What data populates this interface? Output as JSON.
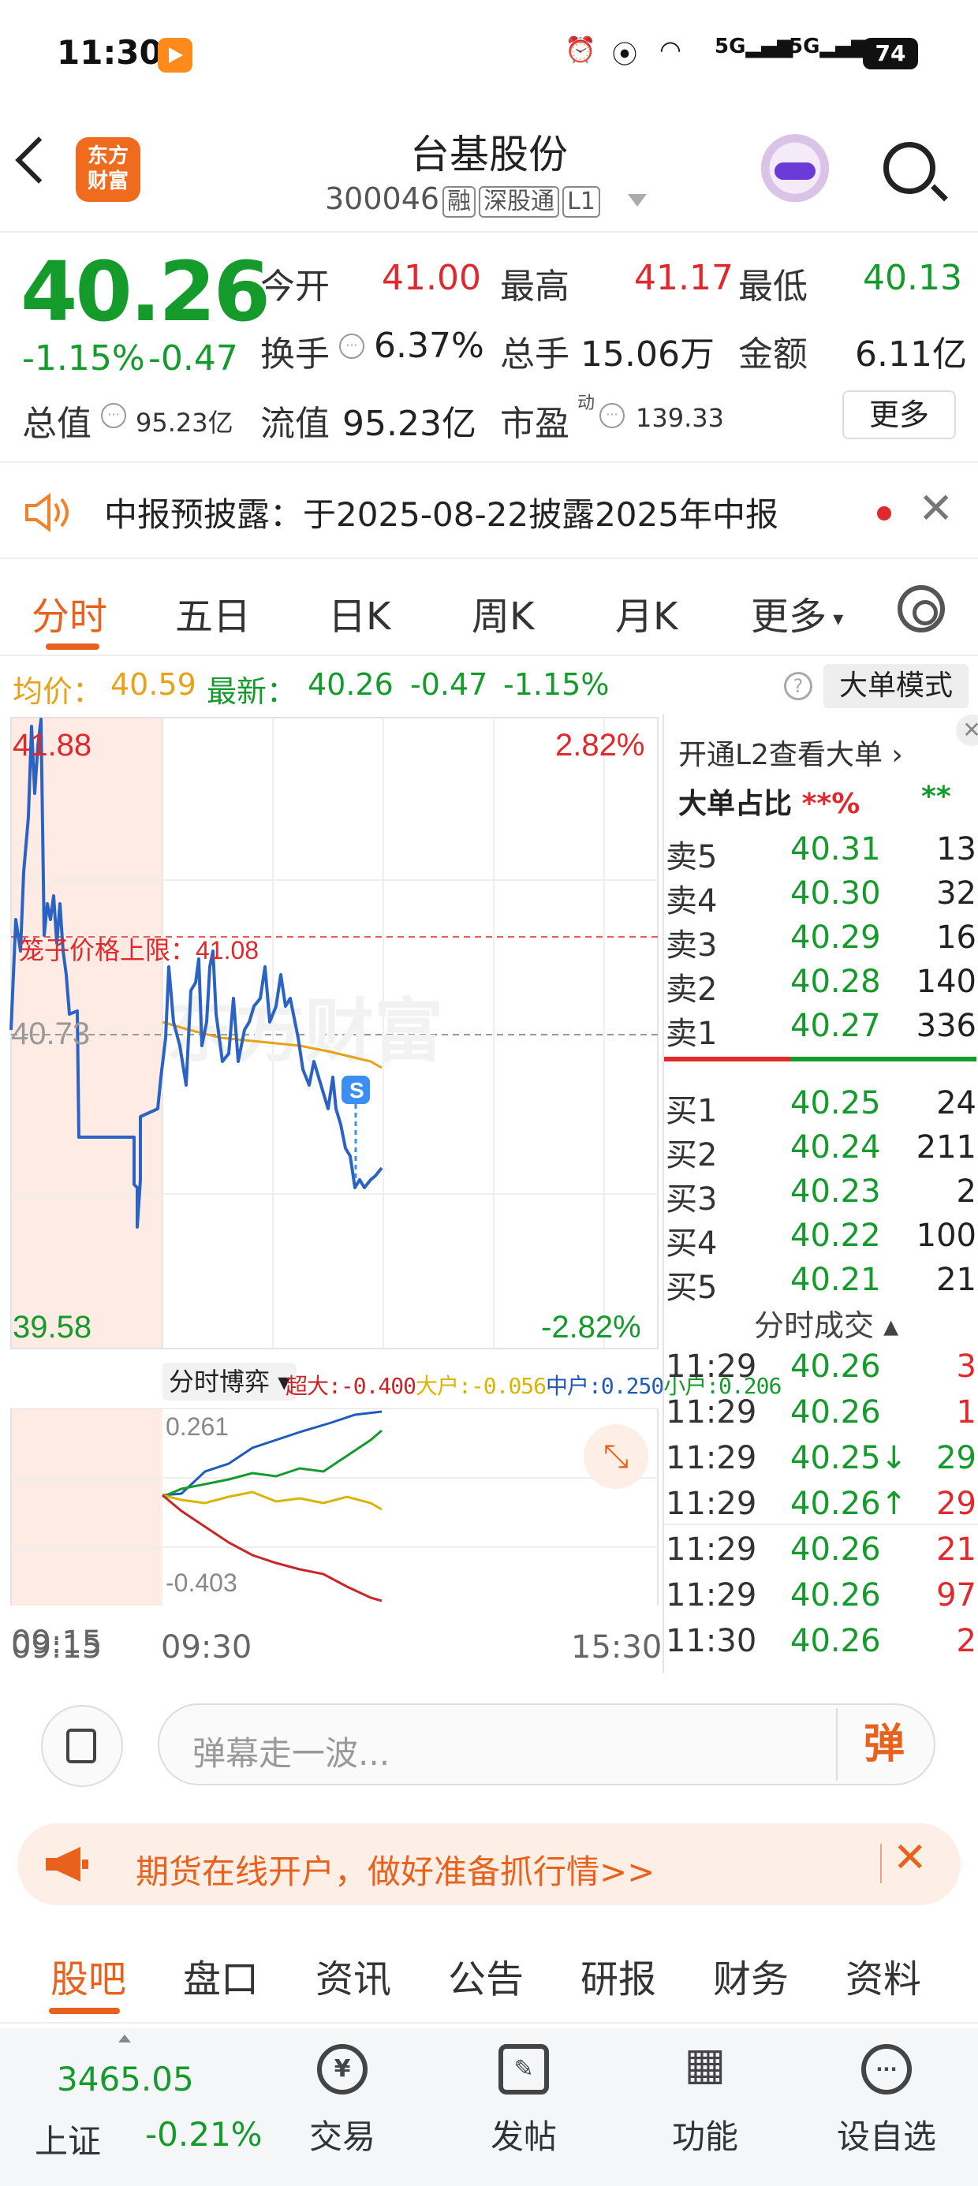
{
  "status_bar": {
    "time": "11:30",
    "battery": "74",
    "network": "5G"
  },
  "header": {
    "stock_name": "台基股份",
    "stock_code": "300046",
    "tags": [
      "融",
      "深股通",
      "L1"
    ]
  },
  "quote": {
    "price": "40.26",
    "change_pct": "-1.15%",
    "change": "-0.47",
    "open_label": "今开",
    "open": "41.00",
    "high_label": "最高",
    "high": "41.17",
    "low_label": "最低",
    "low": "40.13",
    "turnover_label": "换手",
    "turnover": "6.37%",
    "volume_label": "总手",
    "volume": "15.06万",
    "amount_label": "金额",
    "amount": "6.11亿",
    "mktcap_label": "总值",
    "mktcap": "95.23亿",
    "float_label": "流值",
    "float": "95.23亿",
    "pe_label": "市盈",
    "pe_sup": "动",
    "pe": "139.33",
    "more_label": "更多"
  },
  "notice": {
    "text": "中报预披露：于2025-08-22披露2025年中报"
  },
  "tabs": [
    "分时",
    "五日",
    "日K",
    "周K",
    "月K",
    "更多"
  ],
  "avg_line": {
    "avg_label": "均价：",
    "avg": "40.59",
    "latest_label": "最新：",
    "latest": "40.26",
    "chg": "-0.47",
    "pct": "-1.15%",
    "mode_btn": "大单模式"
  },
  "chart": {
    "y_high": "41.88",
    "y_low": "39.58",
    "pct_high": "2.82%",
    "pct_low": "-2.82%",
    "prev_close": "40.73",
    "limit_label": "笼子价格上限：41.08",
    "watermark": "东方财富",
    "x_labels": [
      "09:15",
      "09:30",
      "15:30"
    ],
    "sub_title": "分时博弈",
    "sub_legend": [
      {
        "label": "超大:-0.400",
        "color": "#c9262a"
      },
      {
        "label": "大户:-0.056",
        "color": "#d8b600"
      },
      {
        "label": "中户:0.250",
        "color": "#1f5bbf"
      },
      {
        "label": "小户:0.206",
        "color": "#159a2c"
      }
    ],
    "sub_top": "0.261",
    "sub_bottom": "-0.403"
  },
  "orderbook": {
    "l2_link": "开通L2查看大单 ›",
    "ratio_label": "大单占比",
    "ratio_red": "**%",
    "ratio_green": "**",
    "sells": [
      {
        "label": "卖5",
        "price": "40.31",
        "qty": "13"
      },
      {
        "label": "卖4",
        "price": "40.30",
        "qty": "32"
      },
      {
        "label": "卖3",
        "price": "40.29",
        "qty": "16"
      },
      {
        "label": "卖2",
        "price": "40.28",
        "qty": "140"
      },
      {
        "label": "卖1",
        "price": "40.27",
        "qty": "336"
      }
    ],
    "buys": [
      {
        "label": "买1",
        "price": "40.25",
        "qty": "24"
      },
      {
        "label": "买2",
        "price": "40.24",
        "qty": "211"
      },
      {
        "label": "买3",
        "price": "40.23",
        "qty": "2"
      },
      {
        "label": "买4",
        "price": "40.22",
        "qty": "100"
      },
      {
        "label": "买5",
        "price": "40.21",
        "qty": "21"
      }
    ],
    "trades_title": "分时成交",
    "trades": [
      {
        "time": "11:29",
        "price": "40.26",
        "qty": "3"
      },
      {
        "time": "11:29",
        "price": "40.26",
        "qty": "1"
      },
      {
        "time": "11:29",
        "price": "40.25↓",
        "qty": "29"
      },
      {
        "time": "11:29",
        "price": "40.26↑",
        "qty": "29"
      },
      {
        "time": "11:29",
        "price": "40.26",
        "qty": "21"
      },
      {
        "time": "11:29",
        "price": "40.26",
        "qty": "97"
      },
      {
        "time": "11:30",
        "price": "40.26",
        "qty": "2"
      }
    ]
  },
  "danmu": {
    "placeholder": "弹幕走一波...",
    "button": "弹"
  },
  "promo": {
    "text": "期货在线开户，做好准备抓行情>>"
  },
  "subtabs": [
    "股吧",
    "盘口",
    "资讯",
    "公告",
    "研报",
    "财务",
    "资料"
  ],
  "bottom": {
    "index_value": "3465.05",
    "index_name": "上证",
    "index_pct": "-0.21%",
    "items": [
      {
        "label": "交易",
        "icon": "¥"
      },
      {
        "label": "发帖",
        "icon": "✎"
      },
      {
        "label": "功能",
        "icon": "▦"
      },
      {
        "label": "设自选",
        "icon": "···"
      }
    ]
  }
}
